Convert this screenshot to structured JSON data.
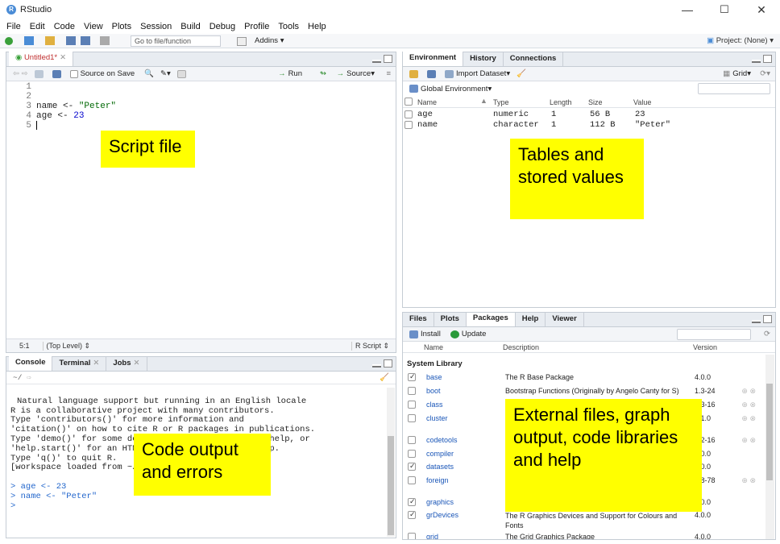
{
  "window": {
    "title": "RStudio",
    "controls": {
      "minimize": "—",
      "maximize": "☐",
      "close": "✕"
    }
  },
  "menu": [
    "File",
    "Edit",
    "Code",
    "View",
    "Plots",
    "Session",
    "Build",
    "Debug",
    "Profile",
    "Tools",
    "Help"
  ],
  "toolbar": {
    "goto_placeholder": "Go to file/function",
    "addins_label": "Addins",
    "project_label": "Project: (None)"
  },
  "source": {
    "tab_label": "Untitled1*",
    "source_on_save": "Source on Save",
    "run_label": "Run",
    "source_label": "Source",
    "line_numbers": [
      "1",
      "2",
      "3",
      "4",
      "5"
    ],
    "lines": [
      {
        "code": ""
      },
      {
        "code": ""
      },
      {
        "name": "name",
        "op": " <- ",
        "value": "\"Peter\""
      },
      {
        "name": "age",
        "op": " <- ",
        "value": "23"
      },
      {
        "code": ""
      }
    ],
    "status_position": "5:1",
    "status_scope": "(Top Level)",
    "status_type": "R Script"
  },
  "console": {
    "tabs": [
      "Console",
      "Terminal",
      "Jobs"
    ],
    "path": "~/",
    "output": [
      "Natural language support but running in an English locale",
      "",
      "R is a collaborative project with many contributors.",
      "Type 'contributors()' for more information and",
      "'citation()' on how to cite R or R packages in publications.",
      "",
      "Type 'demo()' for some demos, 'help()' for on-line help, or",
      "'help.start()' for an HTML browser interface to help.",
      "Type 'q()' to quit R.",
      "",
      "[workspace loaded from ~/.RData]"
    ],
    "inputs": [
      "> age <- 23",
      "> name <- \"Peter\"",
      "> "
    ]
  },
  "environment": {
    "tabs": [
      "Environment",
      "History",
      "Connections"
    ],
    "import_label": "Import Dataset",
    "grid_label": "Grid",
    "scope_label": "Global Environment",
    "columns": [
      "Name",
      "Type",
      "Length",
      "Size",
      "Value"
    ],
    "rows": [
      {
        "name": "age",
        "type": "numeric",
        "length": "1",
        "size": "56 B",
        "value": "23"
      },
      {
        "name": "name",
        "type": "character",
        "length": "1",
        "size": "112 B",
        "value": "\"Peter\""
      }
    ]
  },
  "packages": {
    "tabs": [
      "Files",
      "Plots",
      "Packages",
      "Help",
      "Viewer"
    ],
    "install_label": "Install",
    "update_label": "Update",
    "columns": [
      "Name",
      "Description",
      "Version"
    ],
    "section": "System Library",
    "rows": [
      {
        "name": "base",
        "checked": true,
        "desc": "The R Base Package",
        "version": "4.0.0"
      },
      {
        "name": "boot",
        "checked": false,
        "desc": "Bootstrap Functions (Originally by Angelo Canty for S)",
        "version": "1.3-24"
      },
      {
        "name": "class",
        "checked": false,
        "desc": "",
        "version": "7.3-16"
      },
      {
        "name": "cluster",
        "checked": false,
        "desc": "",
        "version": "2.1.0"
      },
      {
        "name": "codetools",
        "checked": false,
        "desc": "",
        "version": "0.2-16"
      },
      {
        "name": "compiler",
        "checked": false,
        "desc": "",
        "version": "4.0.0"
      },
      {
        "name": "datasets",
        "checked": true,
        "desc": "",
        "version": "4.0.0"
      },
      {
        "name": "foreign",
        "checked": false,
        "desc": "",
        "version": "0.8-78"
      },
      {
        "name": "graphics",
        "checked": true,
        "desc": "",
        "version": "4.0.0"
      },
      {
        "name": "grDevices",
        "checked": true,
        "desc": "The R Graphics Devices and Support for Colours and Fonts",
        "version": "4.0.0"
      },
      {
        "name": "grid",
        "checked": false,
        "desc": "The Grid Graphics Package",
        "version": "4.0.0"
      }
    ]
  },
  "annotations": {
    "script": "Script file",
    "env": "Tables and stored values",
    "console": "Code output and errors",
    "files": "External files, graph output, code libraries and help"
  },
  "colors": {
    "annotation_bg": "#ffff00",
    "pane_border": "#c5ccd4",
    "tab_bg": "#e8ecf1",
    "link": "#1a56b8",
    "console_input": "#2266cc"
  }
}
